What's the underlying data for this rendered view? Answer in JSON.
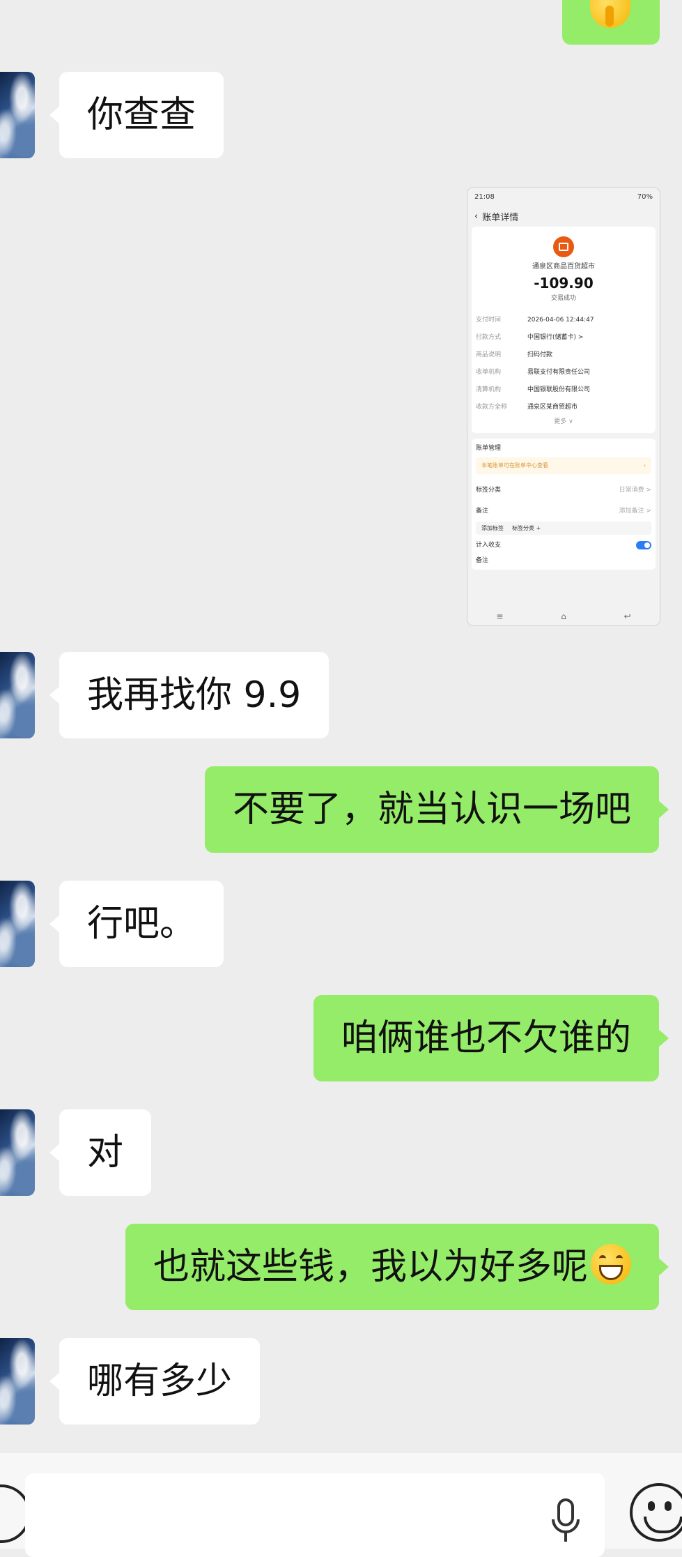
{
  "messages": {
    "m1": "你查查",
    "m3": "我再找你 9.9",
    "m4": "不要了，就当认识一场吧",
    "m5": "行吧。",
    "m6": "咱俩谁也不欠谁的",
    "m7": "对",
    "m8": "也就这些钱，我以为好多呢",
    "m9": "哪有多少"
  },
  "screenshot": {
    "time": "21:08",
    "status_icons": "70%",
    "title": "账单详情",
    "merchant": "通泉区商品百货超市",
    "amount": "-109.90",
    "status": "交易成功",
    "rows": [
      {
        "k": "支付时间",
        "v": "2026-04-06 12:44:47"
      },
      {
        "k": "付款方式",
        "v": "中国银行(储蓄卡) >"
      },
      {
        "k": "商品说明",
        "v": "扫码付款"
      },
      {
        "k": "收单机构",
        "v": "易联支付有限责任公司"
      },
      {
        "k": "清算机构",
        "v": "中国银联股份有限公司"
      },
      {
        "k": "收款方全称",
        "v": "通泉区某商贸超市"
      }
    ],
    "more": "更多 ∨",
    "manage_title": "账单管理",
    "tip": "本笔账单可在账单中心查看",
    "rows2": [
      {
        "k": "标签分类",
        "v": "日常消费 >"
      },
      {
        "k": "备注",
        "v": "添加备注 >"
      }
    ],
    "tag1": "添加标签",
    "tag2": "标签分类 +",
    "count_label": "计入收支",
    "last_label": "备注"
  },
  "input": {
    "placeholder": ""
  }
}
